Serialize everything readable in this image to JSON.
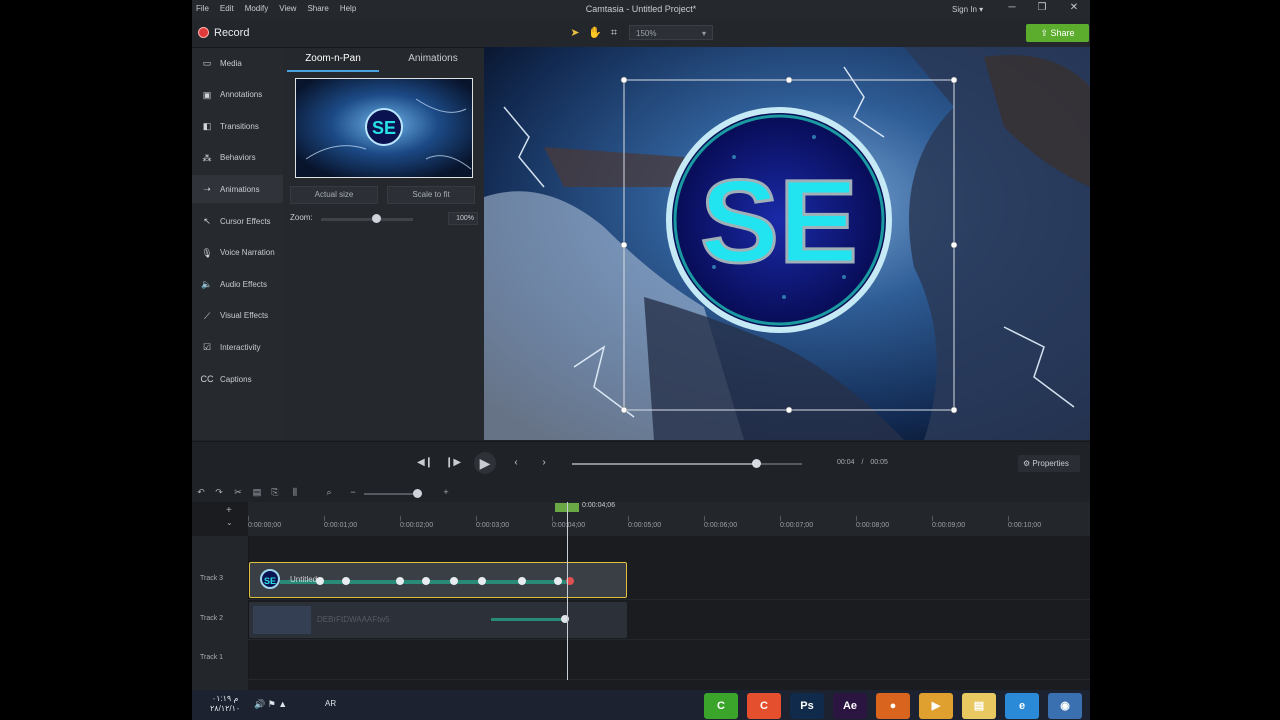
{
  "app": {
    "title": "Camtasia - Untitled Project*",
    "menu": [
      "File",
      "Edit",
      "Modify",
      "View",
      "Share",
      "Help"
    ],
    "signin": "Sign In ▾",
    "window_controls": [
      "─",
      "❐",
      "✕"
    ]
  },
  "toolbar": {
    "record_label": "Record",
    "zoom_value": "150%",
    "share_label": "Share"
  },
  "sidebar": {
    "items": [
      {
        "label": "Media",
        "icon": "film-icon"
      },
      {
        "label": "Annotations",
        "icon": "annotation-icon"
      },
      {
        "label": "Transitions",
        "icon": "transition-icon"
      },
      {
        "label": "Behaviors",
        "icon": "behaviors-icon"
      },
      {
        "label": "Animations",
        "icon": "animation-icon"
      },
      {
        "label": "Cursor Effects",
        "icon": "cursor-icon"
      },
      {
        "label": "Voice Narration",
        "icon": "microphone-icon"
      },
      {
        "label": "Audio Effects",
        "icon": "speaker-icon"
      },
      {
        "label": "Visual Effects",
        "icon": "wand-icon"
      },
      {
        "label": "Interactivity",
        "icon": "interactivity-icon"
      },
      {
        "label": "Captions",
        "icon": "cc-icon"
      }
    ],
    "active_index": 4
  },
  "panel": {
    "tabs": [
      "Zoom-n-Pan",
      "Animations"
    ],
    "actual_size": "Actual size",
    "scale_to_fit": "Scale to fit",
    "zoom_label": "Zoom:",
    "zoom_value": "100%",
    "zoom_level": 0.6
  },
  "canvas": {
    "logo_text": "SE"
  },
  "playback": {
    "current": "00:04",
    "separator": "/",
    "total": "00:05",
    "progress": 0.8,
    "properties_label": "Properties"
  },
  "timeline": {
    "playhead_time": "0:00:04;06",
    "ticks": [
      "0:00:00;00",
      "0:00:01;00",
      "0:00:02;00",
      "0:00:03;00",
      "0:00:04;00",
      "0:00:05;00",
      "0:00:06;00",
      "0:00:07;00",
      "0:00:08;00",
      "0:00:09;00",
      "0:00:10;00"
    ],
    "tracks": [
      {
        "label": "Track 3",
        "clip_text": "Untitled c"
      },
      {
        "label": "Track 2",
        "clip_text": "DEBrFtDWAAAFtw5"
      },
      {
        "label": "Track 1",
        "clip_text": ""
      }
    ]
  },
  "taskbar": {
    "time": "م ٠١:١٩",
    "date": "٢٨/١٢/١٠",
    "lang": "AR",
    "apps": [
      {
        "name": "camtasia-green-icon",
        "glyph": "C",
        "color": "#3aa52a"
      },
      {
        "name": "camtasia-recorder-icon",
        "glyph": "C",
        "color": "#e4502e"
      },
      {
        "name": "photoshop-icon",
        "glyph": "Ps",
        "color": "#0f2a4a"
      },
      {
        "name": "after-effects-icon",
        "glyph": "Ae",
        "color": "#2a1440"
      },
      {
        "name": "firefox-icon",
        "glyph": "●",
        "color": "#d9641d"
      },
      {
        "name": "media-player-icon",
        "glyph": "▶",
        "color": "#e0a030"
      },
      {
        "name": "folder-icon",
        "glyph": "▤",
        "color": "#e8c860"
      },
      {
        "name": "internet-explorer-icon",
        "glyph": "e",
        "color": "#2a8ad8"
      },
      {
        "name": "start-orb-icon",
        "glyph": "◉",
        "color": "#3a6fb0"
      }
    ]
  }
}
